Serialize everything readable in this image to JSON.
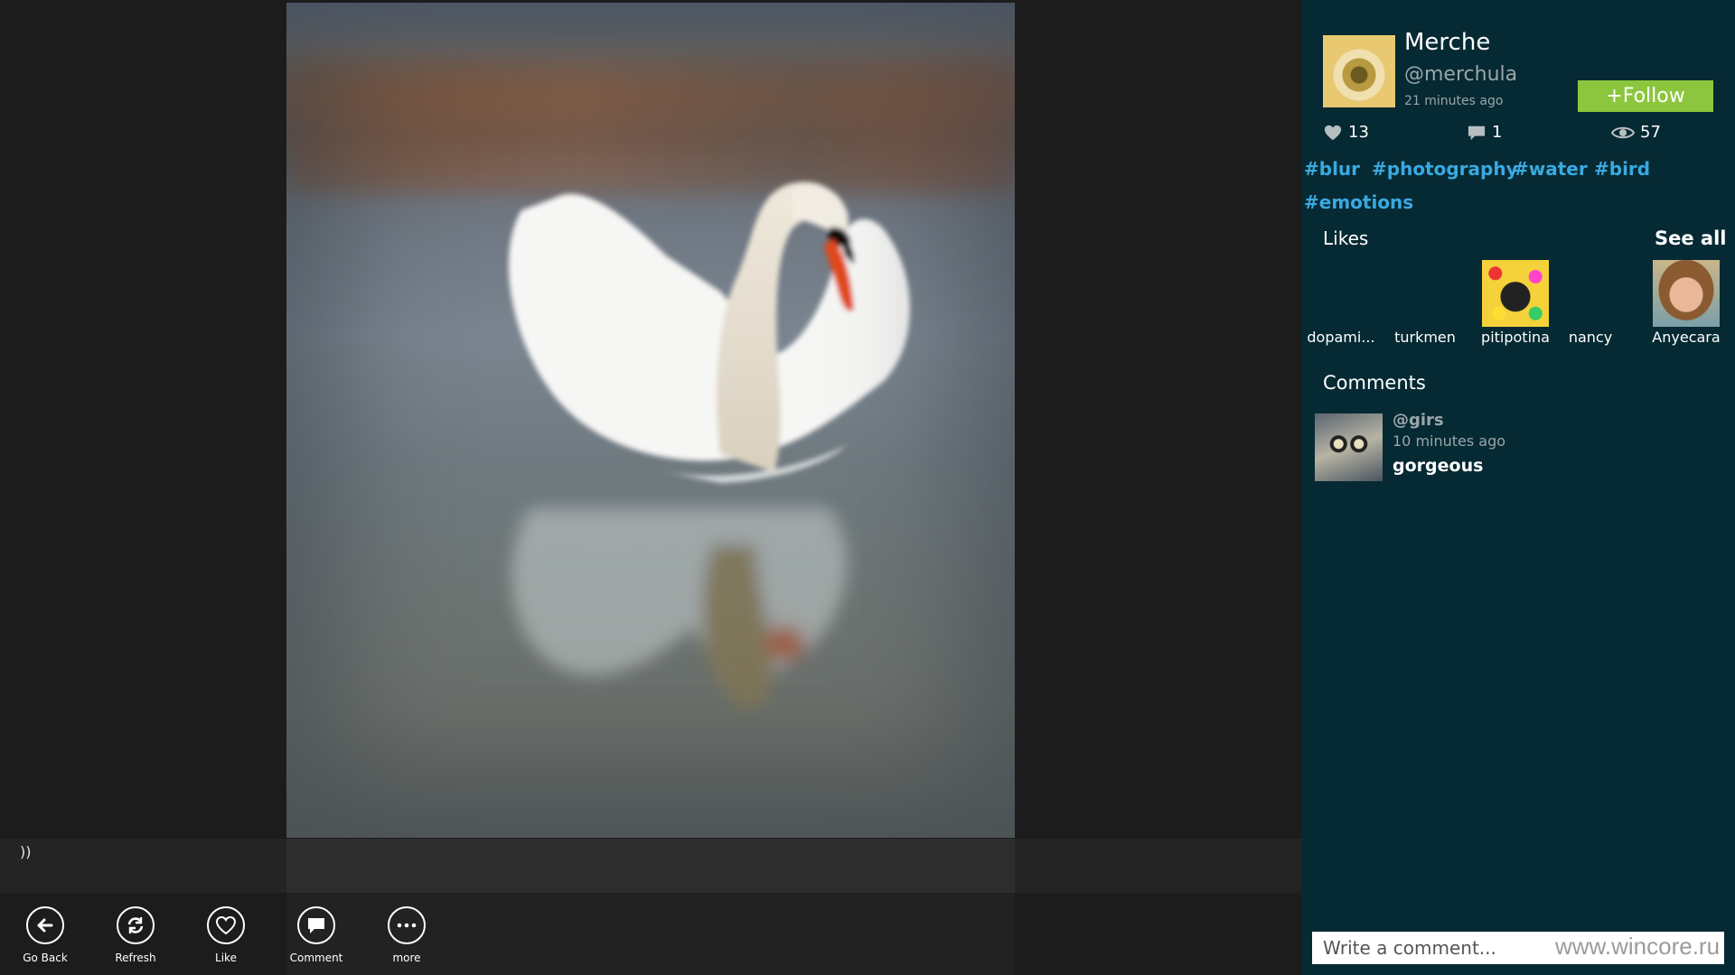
{
  "viewer": {
    "caption": "))",
    "appbar": [
      {
        "label": "Go Back",
        "icon": "back-arrow-icon"
      },
      {
        "label": "Refresh",
        "icon": "refresh-icon"
      },
      {
        "label": "Like",
        "icon": "heart-icon"
      },
      {
        "label": "Comment",
        "icon": "comment-icon"
      },
      {
        "label": "more",
        "icon": "more-icon"
      }
    ]
  },
  "author": {
    "name": "Merche",
    "handle": "@merchula",
    "time": "21 minutes ago",
    "follow_label": "+Follow"
  },
  "stats": {
    "likes": "13",
    "comments": "1",
    "views": "57"
  },
  "tags": [
    "#blur",
    "#photography",
    "#water",
    "#bird",
    "#emotions"
  ],
  "likes": {
    "heading": "Likes",
    "see_all": "See all",
    "users": [
      "dopami...",
      "turkmen",
      "pitipotina",
      "nancy",
      "Anyecara"
    ]
  },
  "comments": {
    "heading": "Comments",
    "items": [
      {
        "user": "@girs",
        "time": "10 minutes ago",
        "text": "gorgeous"
      }
    ]
  },
  "input": {
    "placeholder": "Write a comment..."
  },
  "watermark": "www.wincore.ru",
  "colors": {
    "panel_bg": "#062a33",
    "follow_green": "#8cc63e",
    "tag_blue": "#3aa9e0",
    "viewer_bg": "#1c1c1c"
  }
}
